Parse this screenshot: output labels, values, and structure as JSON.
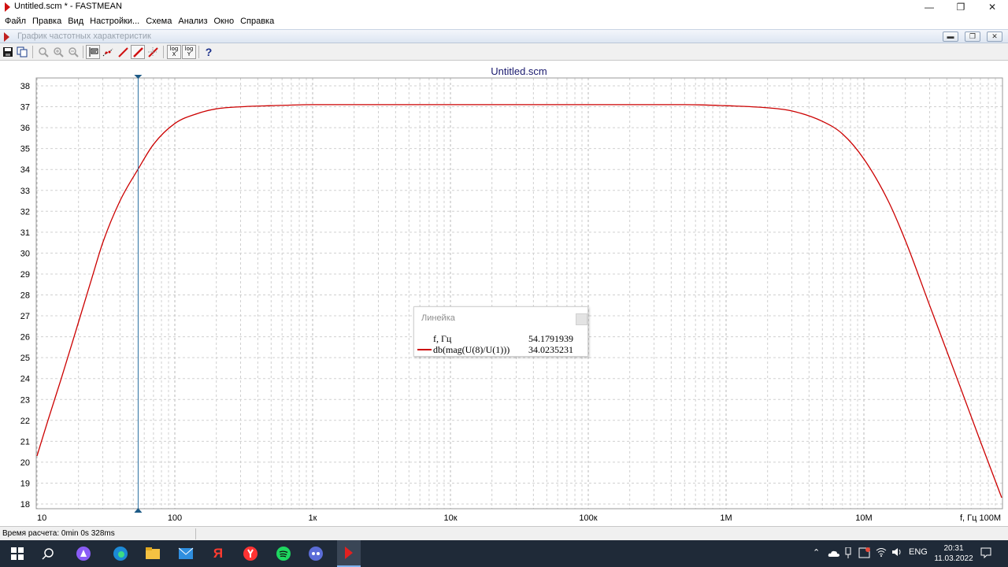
{
  "window": {
    "title": "Untitled.scm * - FASTMEAN"
  },
  "menu": [
    "Файл",
    "Правка",
    "Вид",
    "Настройки...",
    "Схема",
    "Анализ",
    "Окно",
    "Справка"
  ],
  "child_window": {
    "title": "График частотных характеристик"
  },
  "toolbar": {
    "log_x_label": [
      "log",
      "X"
    ],
    "log_y_label": [
      "log",
      "Y"
    ],
    "help_label": "?"
  },
  "chart_data": {
    "type": "line",
    "title": "Untitled.scm",
    "x_scale": "log",
    "xlim": [
      10,
      100000000
    ],
    "ylim": [
      18,
      38
    ],
    "x_ticks": [
      {
        "value": 10,
        "label": "10"
      },
      {
        "value": 100,
        "label": "100"
      },
      {
        "value": 1000,
        "label": "1к"
      },
      {
        "value": 10000,
        "label": "10к"
      },
      {
        "value": 100000,
        "label": "100к"
      },
      {
        "value": 1000000,
        "label": "1M"
      },
      {
        "value": 10000000,
        "label": "10M"
      },
      {
        "value": 100000000,
        "label": "f, Гц 100M"
      }
    ],
    "y_ticks": [
      18,
      19,
      20,
      21,
      22,
      23,
      24,
      25,
      26,
      27,
      28,
      29,
      30,
      31,
      32,
      33,
      34,
      35,
      36,
      37,
      38
    ],
    "grid": true,
    "series": [
      {
        "name": "db(mag(U(8)/U(1)))",
        "color": "#cc0000",
        "x": [
          10,
          12,
          15,
          20,
          25,
          30,
          40,
          54.18,
          70,
          100,
          150,
          200,
          300,
          500,
          1000,
          10000,
          100000,
          500000,
          1000000,
          2000000,
          3000000,
          5000000,
          7000000,
          10000000,
          15000000,
          20000000,
          30000000,
          50000000,
          70000000,
          100000000
        ],
        "y": [
          20.3,
          22.0,
          24.0,
          26.7,
          28.8,
          30.5,
          32.5,
          34.02,
          35.2,
          36.2,
          36.7,
          36.9,
          37.0,
          37.05,
          37.1,
          37.1,
          37.1,
          37.1,
          37.05,
          36.95,
          36.8,
          36.3,
          35.7,
          34.5,
          32.5,
          30.6,
          27.5,
          23.6,
          21.0,
          18.3
        ]
      }
    ],
    "cursor": {
      "x": 54.1791939
    }
  },
  "ruler": {
    "title": "Линейка",
    "rows": [
      {
        "key": "f, Гц",
        "value": "54.1791939"
      },
      {
        "key": "db(mag(U(8)/U(1)))",
        "value": "34.0235231"
      }
    ]
  },
  "status": {
    "text": "Время расчета: 0min 0s 328ms"
  },
  "taskbar": {
    "language": "ENG",
    "time": "20:31",
    "date": "11.03.2022",
    "browser_label": "Я"
  }
}
